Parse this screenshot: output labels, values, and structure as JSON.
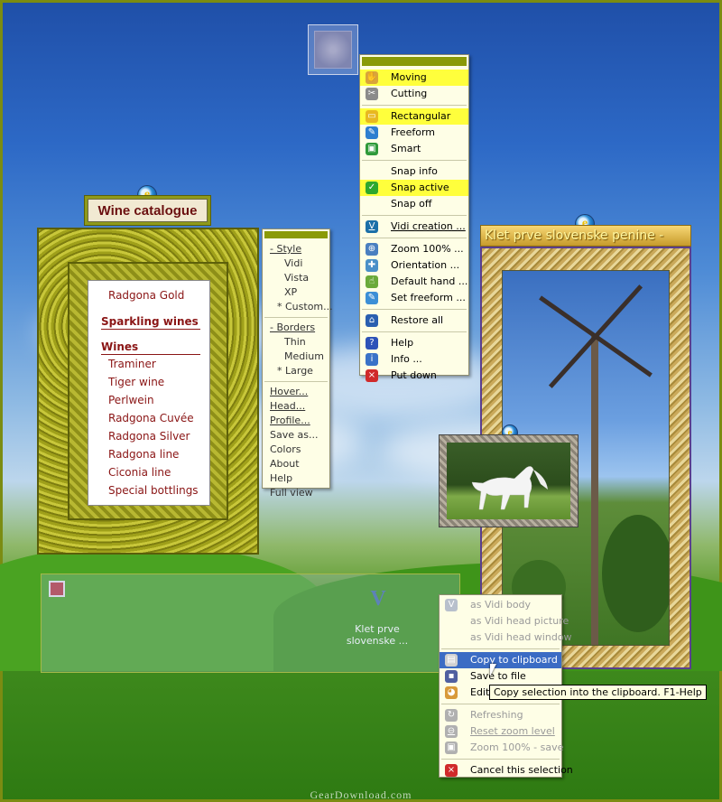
{
  "main_menu": {
    "items": [
      {
        "label": "Moving",
        "icon": "moving-icon",
        "highlight": true
      },
      {
        "label": "Cutting",
        "icon": "scissors-icon"
      },
      {
        "sep": true
      },
      {
        "label": "Rectangular",
        "icon": "rectangle-icon",
        "highlight": true
      },
      {
        "label": "Freeform",
        "icon": "freeform-icon"
      },
      {
        "label": "Smart",
        "icon": "smart-icon"
      },
      {
        "sep": true
      },
      {
        "label": "Snap info"
      },
      {
        "label": "Snap active",
        "icon": "check-icon",
        "highlight": true
      },
      {
        "label": "Snap off"
      },
      {
        "sep": true
      },
      {
        "label": "Vidi creation ...",
        "icon": "vidi-icon",
        "underline": true
      },
      {
        "sep": true
      },
      {
        "label": "Zoom 100% ...",
        "icon": "zoom-icon"
      },
      {
        "label": "Orientation ...",
        "icon": "orientation-icon"
      },
      {
        "label": "Default hand ...",
        "icon": "hand-icon"
      },
      {
        "label": "Set freeform ...",
        "icon": "set-freeform-icon"
      },
      {
        "sep": true
      },
      {
        "label": "Restore all",
        "icon": "home-icon"
      },
      {
        "sep": true
      },
      {
        "label": "Help",
        "icon": "help-icon"
      },
      {
        "label": "Info ...",
        "icon": "info-icon"
      },
      {
        "label": "Put down",
        "icon": "close-icon"
      }
    ]
  },
  "style_menu": {
    "style_head": "- Style",
    "style_items": [
      "Vidi",
      "Vista",
      "XP",
      "* Custom..."
    ],
    "borders_head": "- Borders",
    "border_items": [
      "Thin",
      "Medium",
      "* Large"
    ],
    "links": [
      "Hover...",
      "Head...",
      "Profile..."
    ],
    "plain": [
      "Save as...",
      "Colors",
      "About",
      "Help",
      "Full view"
    ]
  },
  "wine": {
    "title": "Wine catalogue",
    "top_item": "Radgona Gold",
    "sparkling_label": "Sparkling wines",
    "wines_label": "Wines",
    "items": [
      "Traminer",
      "Tiger wine",
      "Perlwein",
      "Radgona Cuvée",
      "Radgona Silver",
      "Radgona line",
      "Ciconia line",
      "Special bottlings"
    ]
  },
  "klet": {
    "title": "Klet prve slovenske penine -"
  },
  "vidi_panel": {
    "logo": "V",
    "caption_line1": "Klet prve",
    "caption_line2": "slovenske ..."
  },
  "context_menu": {
    "items": [
      {
        "label": "as Vidi body",
        "icon": "vidi-body-icon",
        "disabled": true
      },
      {
        "label": "as Vidi head picture",
        "disabled": true
      },
      {
        "label": "as Vidi head window",
        "disabled": true
      },
      {
        "sep": true
      },
      {
        "label": "Copy to clipboard",
        "icon": "clipboard-icon",
        "selected": true
      },
      {
        "label": "Save to file",
        "icon": "save-icon"
      },
      {
        "label": "Edit",
        "icon": "palette-icon"
      },
      {
        "sep": true
      },
      {
        "label": "Refreshing",
        "icon": "refresh-icon",
        "disabled": true
      },
      {
        "label": "Reset zoom level",
        "icon": "reset-zoom-icon",
        "disabled": true,
        "underline": true
      },
      {
        "label": "Zoom 100% - save",
        "icon": "zoom-save-icon",
        "disabled": true
      },
      {
        "sep": true
      },
      {
        "label": "Cancel this selection",
        "icon": "cancel-icon"
      }
    ]
  },
  "tooltip": "Copy selection into the clipboard. F1-Help",
  "watermark": "GearDownload.com",
  "colors": {
    "menu_bg": "#fefee6",
    "highlight": "#ffff3c",
    "selected": "#3b6cc4",
    "wine_text": "#8a1515"
  }
}
